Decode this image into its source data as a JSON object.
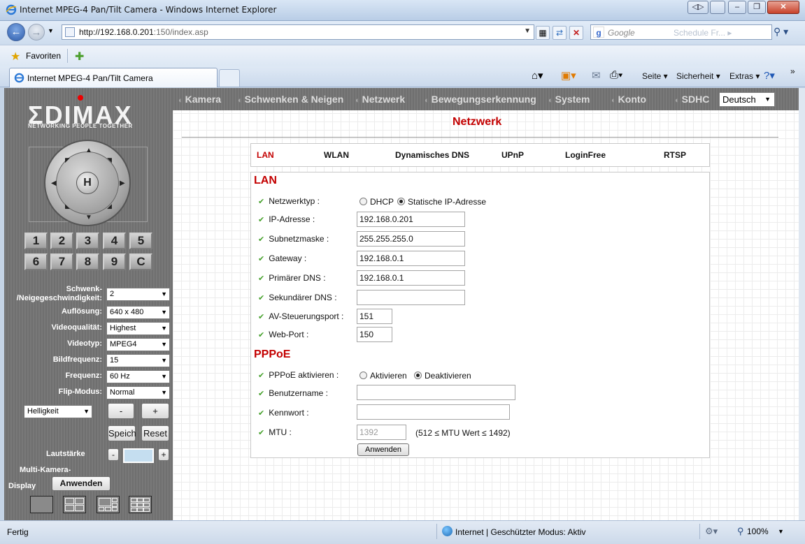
{
  "window": {
    "title": "Internet MPEG-4 Pan/Tilt Camera - Windows Internet Explorer",
    "minimize": "–",
    "restore": "❐",
    "close": "✕",
    "extra": "◁▷"
  },
  "browser": {
    "url_host": "http://192.168.0.201",
    "url_path": ":150/index.asp",
    "search_provider": "Google",
    "search_faded": "Schedule Fr... ▸",
    "favorites_label": "Favoriten",
    "tab_title": "Internet MPEG-4 Pan/Tilt Camera",
    "cmd_page": "Seite ▾",
    "cmd_security": "Sicherheit ▾",
    "cmd_extras": "Extras ▾",
    "cmd_more": "»"
  },
  "sidebar": {
    "logo": "ΣDIMAX",
    "tagline": "NETWORKING PEOPLE TOGETHER",
    "ptz_home": "H",
    "presets": [
      "1",
      "2",
      "3",
      "4",
      "5",
      "6",
      "7",
      "8",
      "9",
      "C"
    ],
    "speed_label": "Schwenk- /Neigegeschwindigkeit:",
    "speed_value": "2",
    "resolution_label": "Auflösung:",
    "resolution_value": "640 x 480",
    "quality_label": "Videoqualität:",
    "quality_value": "Highest",
    "videotype_label": "Videotyp:",
    "videotype_value": "MPEG4",
    "framerate_label": "Bildfrequenz:",
    "framerate_value": "15",
    "frequency_label": "Frequenz:",
    "frequency_value": "60 Hz",
    "flip_label": "Flip-Modus:",
    "flip_value": "Normal",
    "brightness_value": "Helligkeit",
    "minus": "-",
    "plus": "+",
    "save": "Speich",
    "reset": "Reset",
    "volume_label": "Lautstärke",
    "multicam_label1": "Multi-Kamera-",
    "multicam_label2": "Display",
    "apply": "Anwenden"
  },
  "topnav": {
    "items": [
      "Kamera",
      "Schwenken & Neigen",
      "Netzwerk",
      "Bewegungserkennung",
      "System",
      "Konto",
      "SDHC"
    ],
    "language": "Deutsch"
  },
  "page": {
    "title": "Netzwerk",
    "subtabs": [
      "LAN",
      "WLAN",
      "Dynamisches DNS",
      "UPnP",
      "LoginFree",
      "RTSP"
    ]
  },
  "lan": {
    "heading": "LAN",
    "type_label": "Netzwerktyp :",
    "type_dhcp": "DHCP",
    "type_static": "Statische IP-Adresse",
    "ip_label": "IP-Adresse :",
    "ip_value": "192.168.0.201",
    "mask_label": "Subnetzmaske :",
    "mask_value": "255.255.255.0",
    "gateway_label": "Gateway :",
    "gateway_value": "192.168.0.1",
    "dns1_label": "Primärer DNS :",
    "dns1_value": "192.168.0.1",
    "dns2_label": "Sekundärer DNS :",
    "dns2_value": "",
    "av_port_label": "AV-Steuerungsport :",
    "av_port_value": "151",
    "web_port_label": "Web-Port :",
    "web_port_value": "150"
  },
  "pppoe": {
    "heading": "PPPoE",
    "enable_label": "PPPoE aktivieren :",
    "enable_on": "Aktivieren",
    "enable_off": "Deaktivieren",
    "user_label": "Benutzername :",
    "user_value": "",
    "pass_label": "Kennwort :",
    "pass_value": "",
    "mtu_label": "MTU :",
    "mtu_value": "1392",
    "mtu_hint": "(512 ≤ MTU Wert ≤ 1492)",
    "apply": "Anwenden"
  },
  "status": {
    "left": "Fertig",
    "zone": "Internet | Geschützter Modus: Aktiv",
    "zoom": "100%"
  }
}
